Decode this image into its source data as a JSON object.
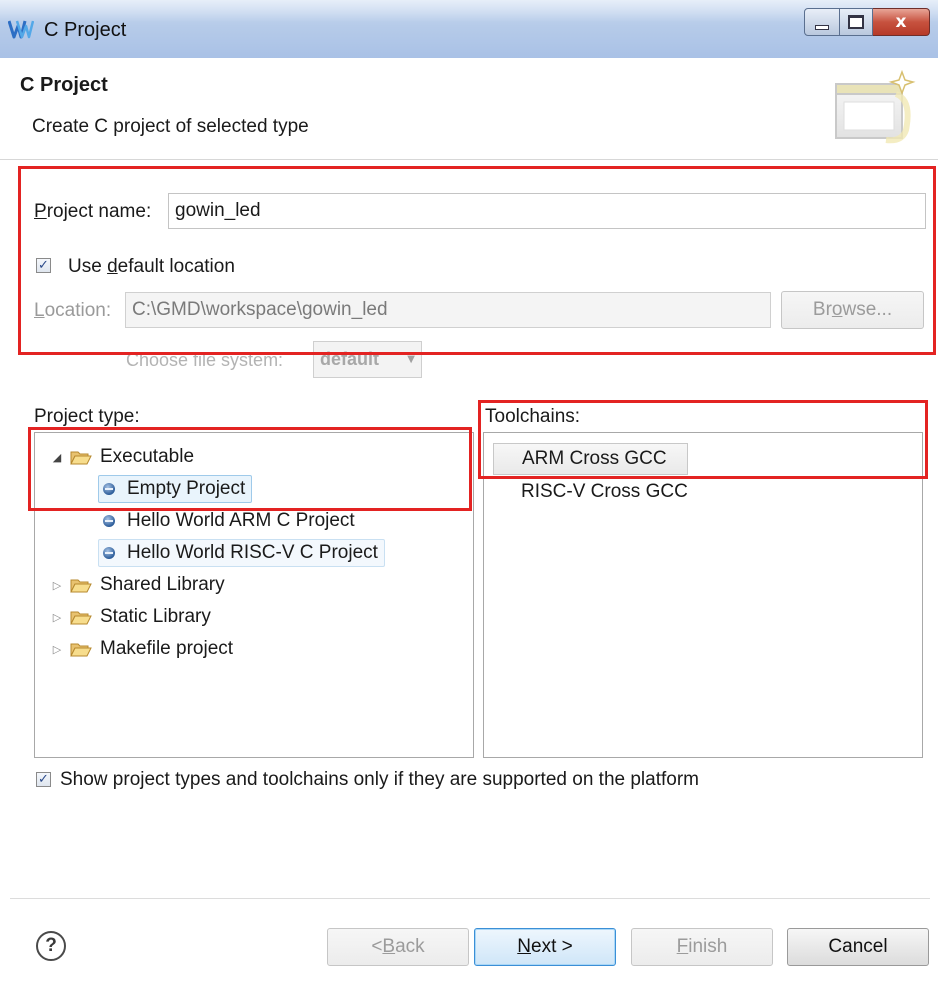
{
  "window": {
    "title": "C Project",
    "controls": {
      "minimize": "minimize",
      "maximize": "maximize",
      "close": "x"
    }
  },
  "header": {
    "title": "C Project",
    "description": "Create C project of selected type"
  },
  "form": {
    "project_name_label_pre": "",
    "project_name_label_underline": "P",
    "project_name_label_post": "roject name:",
    "project_name_value": "gowin_led",
    "use_default_location_pre": "Use ",
    "use_default_location_underline": "d",
    "use_default_location_post": "efault location",
    "use_default_location_checked": true,
    "location_label_underline": "L",
    "location_label_post": "ocation:",
    "location_value": "C:\\GMD\\workspace\\gowin_led",
    "browse_pre": "Br",
    "browse_underline": "o",
    "browse_post": "wse...",
    "file_system_label": "Choose file system:",
    "file_system_value": "default"
  },
  "project_type": {
    "label": "Project type:",
    "items": [
      {
        "label": "Executable",
        "kind": "folder",
        "expanded": true
      },
      {
        "label": "Empty Project",
        "kind": "leaf",
        "selected": true
      },
      {
        "label": "Hello World ARM C Project",
        "kind": "leaf"
      },
      {
        "label": "Hello World RISC-V C Project",
        "kind": "leaf",
        "highlighted": true
      },
      {
        "label": "Shared Library",
        "kind": "folder",
        "expanded": false
      },
      {
        "label": "Static Library",
        "kind": "folder",
        "expanded": false
      },
      {
        "label": "Makefile project",
        "kind": "folder",
        "expanded": false
      }
    ]
  },
  "toolchains": {
    "label": "Toolchains:",
    "items": [
      {
        "label": "ARM Cross GCC",
        "selected": true
      },
      {
        "label": "RISC-V Cross GCC"
      }
    ]
  },
  "filter": {
    "label": "Show project types and toolchains only if they are supported on the platform",
    "checked": true
  },
  "buttons": {
    "help": "?",
    "back_pre": "< ",
    "back_underline": "B",
    "back_post": "ack",
    "next_underline": "N",
    "next_post": "ext >",
    "finish_underline": "F",
    "finish_post": "inish",
    "cancel": "Cancel"
  },
  "annotation_color": "#e32322"
}
